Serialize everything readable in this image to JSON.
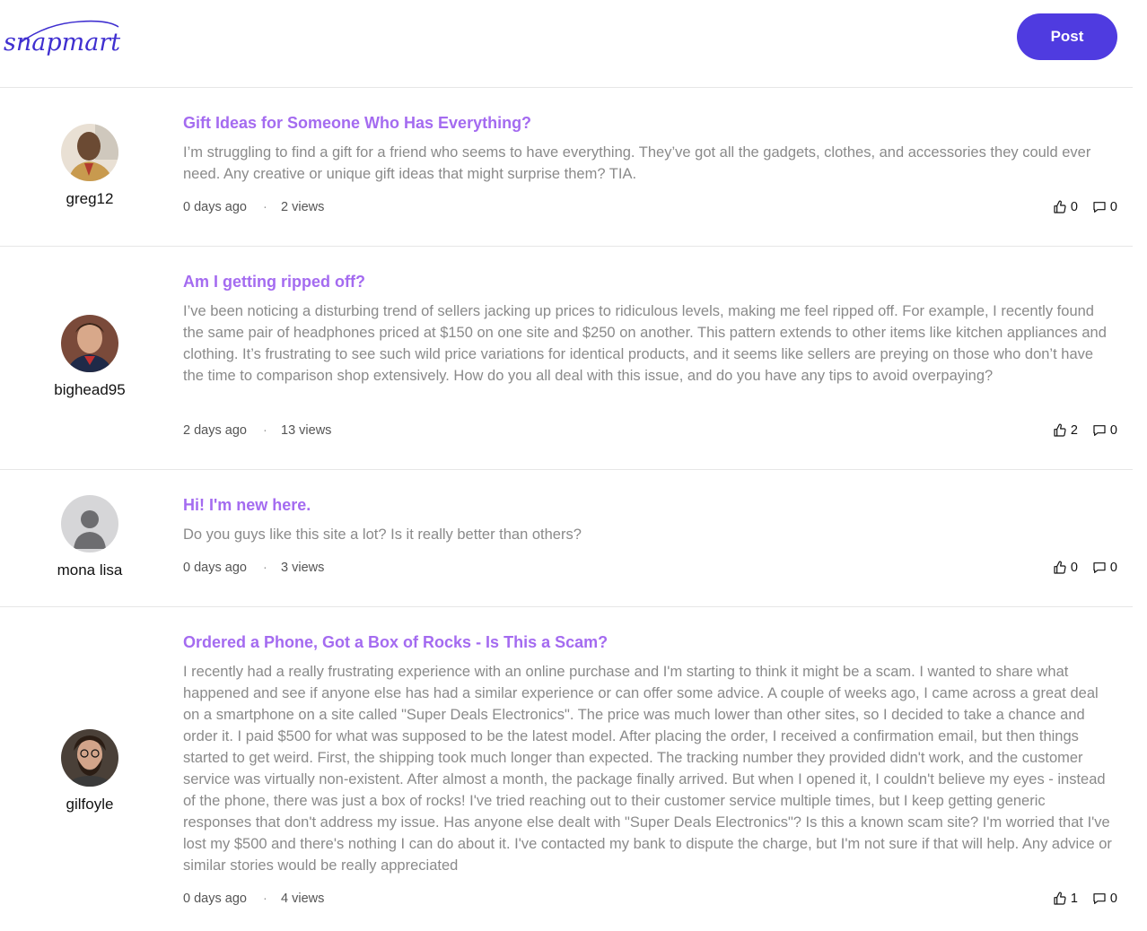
{
  "app": {
    "logo_text": "snapmart",
    "post_button": "Post",
    "brand_color": "#4f3be0",
    "title_color": "#a46bf0"
  },
  "posts": [
    {
      "author": "greg12",
      "avatar": "photo",
      "title": "Gift Ideas for Someone Who Has Everything?",
      "body": "I’m struggling to find a gift for a friend who seems to have everything. They’ve got all the gadgets, clothes, and accessories they could ever need. Any creative or unique gift ideas that might surprise them? TIA.",
      "time": "0 days ago",
      "views": "2 views",
      "likes": "0",
      "comments": "0"
    },
    {
      "author": "bighead95",
      "avatar": "photo",
      "title": "Am I getting ripped off?",
      "body": "I’ve been noticing a disturbing trend of sellers jacking up prices to ridiculous levels, making me feel ripped off. For example, I recently found the same pair of headphones priced at $150 on one site and $250 on another. This pattern extends to other items like kitchen appliances and clothing. It’s frustrating to see such wild price variations for identical products, and it seems like sellers are preying on those who don’t have the time to comparison shop extensively. How do you all deal with this issue, and do you have any tips to avoid overpaying?",
      "time": "2 days ago",
      "views": "13 views",
      "likes": "2",
      "comments": "0"
    },
    {
      "author": "mona lisa",
      "avatar": "default-user-icon",
      "title": "Hi! I'm new here.",
      "body": "Do you guys like this site a lot? Is it really better than others?",
      "time": "0 days ago",
      "views": "3 views",
      "likes": "0",
      "comments": "0"
    },
    {
      "author": "gilfoyle",
      "avatar": "photo",
      "title": "Ordered a Phone, Got a Box of Rocks - Is This a Scam?",
      "body": "I recently had a really frustrating experience with an online purchase and I'm starting to think it might be a scam. I wanted to share what happened and see if anyone else has had a similar experience or can offer some advice. A couple of weeks ago, I came across a great deal on a smartphone on a site called \"Super Deals Electronics\". The price was much lower than other sites, so I decided to take a chance and order it. I paid $500 for what was supposed to be the latest model. After placing the order, I received a confirmation email, but then things started to get weird. First, the shipping took much longer than expected. The tracking number they provided didn't work, and the customer service was virtually non-existent. After almost a month, the package finally arrived. But when I opened it, I couldn't believe my eyes - instead of the phone, there was just a box of rocks! I've tried reaching out to their customer service multiple times, but I keep getting generic responses that don't address my issue. Has anyone else dealt with \"Super Deals Electronics\"? Is this a known scam site? I'm worried that I've lost my $500 and there's nothing I can do about it. I've contacted my bank to dispute the charge, but I'm not sure if that will help. Any advice or similar stories would be really appreciated",
      "time": "0 days ago",
      "views": "4 views",
      "likes": "1",
      "comments": "0"
    }
  ]
}
